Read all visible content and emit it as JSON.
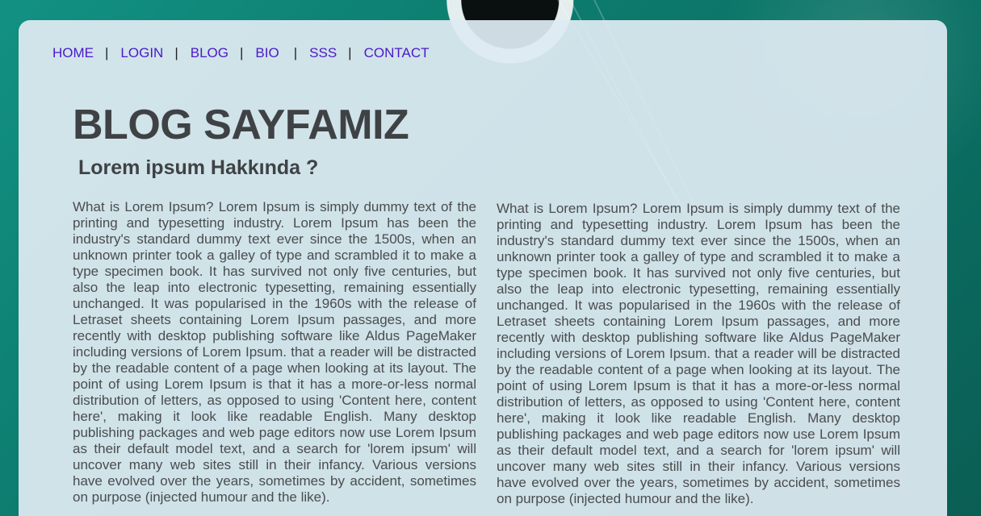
{
  "nav": {
    "items": [
      {
        "label": "HOME"
      },
      {
        "label": "LOGIN"
      },
      {
        "label": "BLOG"
      },
      {
        "label": "BIO"
      },
      {
        "label": "SSS"
      },
      {
        "label": "CONTACT"
      }
    ],
    "separator": "|"
  },
  "header": {
    "title": "BLOG SAYFAMIZ",
    "subtitle": "Lorem ipsum Hakkında ?"
  },
  "content": {
    "columns": [
      {
        "text": "What is Lorem Ipsum? Lorem Ipsum is simply dummy text of the printing and typesetting industry. Lorem Ipsum has been the industry's standard dummy text ever since the 1500s, when an unknown printer took a galley of type and scrambled it to make a type specimen book. It has survived not only five centuries, but also the leap into electronic typesetting, remaining essentially unchanged. It was popularised in the 1960s with the release of Letraset sheets containing Lorem Ipsum passages, and more recently with desktop publishing software like Aldus PageMaker including versions of Lorem Ipsum. that a reader will be distracted by the readable content of a page when looking at its layout. The point of using Lorem Ipsum is that it has a more-or-less normal distribution of letters, as opposed to using 'Content here, content here', making it look like readable English. Many desktop publishing packages and web page editors now use Lorem Ipsum as their default model text, and a search for 'lorem ipsum' will uncover many web sites still in their infancy. Various versions have evolved over the years, sometimes by accident, sometimes on purpose (injected humour and the like)."
      },
      {
        "text": "What is Lorem Ipsum? Lorem Ipsum is simply dummy text of the printing and typesetting industry. Lorem Ipsum has been the industry's standard dummy text ever since the 1500s, when an unknown printer took a galley of type and scrambled it to make a type specimen book. It has survived not only five centuries, but also the leap into electronic typesetting, remaining essentially unchanged. It was popularised in the 1960s with the release of Letraset sheets containing Lorem Ipsum passages, and more recently with desktop publishing software like Aldus PageMaker including versions of Lorem Ipsum. that a reader will be distracted by the readable content of a page when looking at its layout. The point of using Lorem Ipsum is that it has a more-or-less normal distribution of letters, as opposed to using 'Content here, content here', making it look like readable English. Many desktop publishing packages and web page editors now use Lorem Ipsum as their default model text, and a search for 'lorem ipsum' will uncover many web sites still in their infancy. Various versions have evolved over the years, sometimes by accident, sometimes on purpose (injected humour and the like)."
      }
    ]
  },
  "colors": {
    "link": "#4b19c9",
    "heading": "#3f4245",
    "body_text": "#4a4c4e",
    "panel": "#dfebf2",
    "background": "#0e7c6f"
  }
}
